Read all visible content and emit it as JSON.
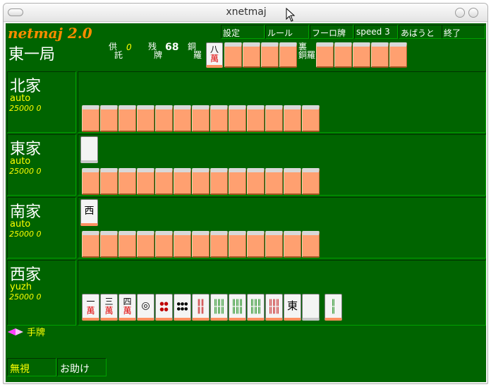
{
  "window": {
    "title": "xnetmaj"
  },
  "game": {
    "logo": "netmaj 2.0",
    "menu": [
      "設定",
      "ルール",
      "フーロ牌",
      "speed 3",
      "あばうと",
      "終了"
    ],
    "round": "東一局",
    "kyoutaku_label": [
      "供",
      "託"
    ],
    "kyoutaku_value": "0",
    "remaining_label": [
      "残",
      "牌"
    ],
    "remaining_value": "68",
    "dora_label": [
      "銅",
      "羅"
    ],
    "uradora_label": [
      "裏",
      "銅羅"
    ],
    "dora_indicator": {
      "top": "八",
      "bottom": "萬"
    },
    "players": [
      {
        "seat": "北家",
        "name": "auto",
        "score": "25000 0"
      },
      {
        "seat": "東家",
        "name": "auto",
        "score": "25000 0"
      },
      {
        "seat": "南家",
        "name": "auto",
        "score": "25000 0"
      },
      {
        "seat": "西家",
        "name": "yuzh",
        "score": "25000 0"
      }
    ],
    "south_discard": "西",
    "hand": [
      {
        "top": "一",
        "bottom": "萬"
      },
      {
        "top": "三",
        "bottom": "萬"
      },
      {
        "top": "四",
        "bottom": "萬"
      },
      {
        "top": "◎",
        "bottom": ""
      },
      {
        "top": "●●",
        "bottom": "●●"
      },
      {
        "top": "●●●",
        "bottom": "●●●"
      },
      {
        "top": "‖‖",
        "bottom": "‖‖"
      },
      {
        "top": "‖‖‖",
        "bottom": "‖‖‖"
      },
      {
        "top": "‖‖‖",
        "bottom": "‖‖‖"
      },
      {
        "top": "‖‖‖",
        "bottom": "‖‖‖"
      },
      {
        "top": "‖‖‖",
        "bottom": "‖‖‖"
      },
      {
        "top": "東",
        "bottom": ""
      },
      {
        "top": "",
        "bottom": ""
      }
    ],
    "drawn_tile": {
      "top": "‖",
      "bottom": "‖"
    },
    "hand_label": "手牌",
    "buttons": {
      "ignore": "無視",
      "help": "お助け"
    },
    "colors": {
      "table": "#006400",
      "tile_back": "#ffa070",
      "accent_yellow": "#ffff00"
    }
  }
}
